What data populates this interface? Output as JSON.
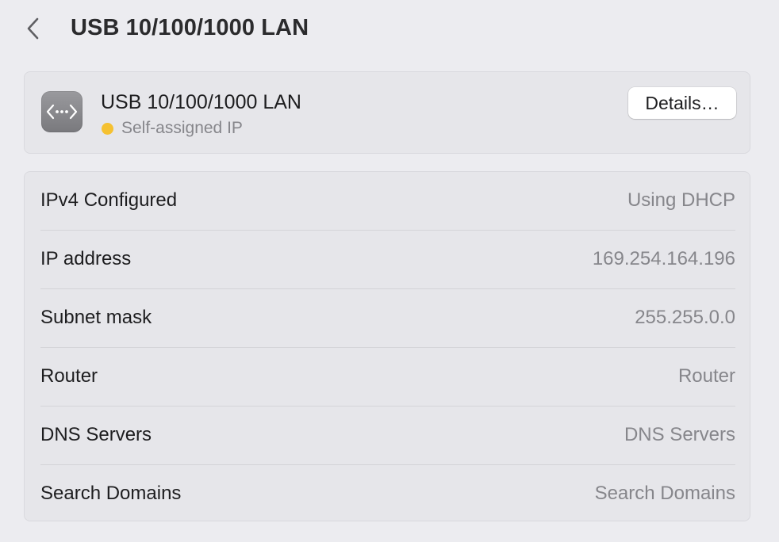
{
  "header": {
    "title": "USB 10/100/1000 LAN",
    "back_icon": "chevron-left-icon"
  },
  "interface": {
    "icon": "ethernet-icon",
    "name": "USB 10/100/1000 LAN",
    "status": "Self-assigned IP",
    "status_color": "#f5c131",
    "details_button_label": "Details…"
  },
  "details": {
    "rows": [
      {
        "label": "IPv4 Configured",
        "value": "Using DHCP"
      },
      {
        "label": "IP address",
        "value": "169.254.164.196"
      },
      {
        "label": "Subnet mask",
        "value": "255.255.0.0"
      },
      {
        "label": "Router",
        "value": "Router"
      },
      {
        "label": "DNS Servers",
        "value": "DNS Servers"
      },
      {
        "label": "Search Domains",
        "value": "Search Domains"
      }
    ]
  }
}
